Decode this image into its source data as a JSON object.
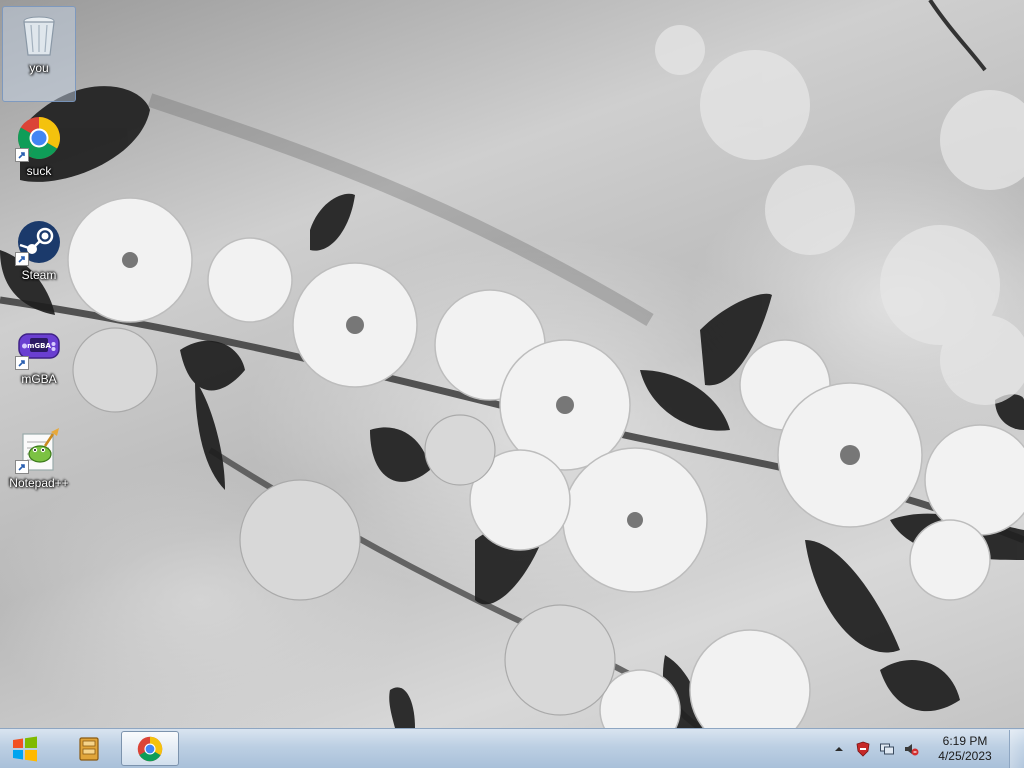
{
  "desktop": {
    "icons": [
      {
        "label": "you",
        "icon": "recycle-bin-icon",
        "shortcut": false,
        "selected": true
      },
      {
        "label": "suck",
        "icon": "chrome-icon",
        "shortcut": true,
        "selected": false
      },
      {
        "label": "Steam",
        "icon": "steam-icon",
        "shortcut": true,
        "selected": false
      },
      {
        "label": "mGBA",
        "icon": "mgba-icon",
        "shortcut": true,
        "selected": false
      },
      {
        "label": "Notepad++",
        "icon": "notepadpp-icon",
        "shortcut": true,
        "selected": false
      }
    ]
  },
  "taskbar": {
    "start": {
      "icon": "windows-logo-icon"
    },
    "pinned": [
      {
        "icon": "file-explorer-icon",
        "active": false
      },
      {
        "icon": "chrome-icon",
        "active": true
      }
    ],
    "tray": {
      "icons": [
        "show-hidden-icons-chevron",
        "security-shield-icon",
        "network-icon",
        "volume-muted-icon"
      ],
      "time": "6:19 PM",
      "date": "4/25/2023"
    }
  },
  "colors": {
    "taskbar_top": "#d9e4f0",
    "taskbar_bottom": "#a9c0d9",
    "chrome_red": "#db4437",
    "chrome_yellow": "#f4c20d",
    "chrome_green": "#0f9d58",
    "chrome_blue": "#4285f4",
    "steam_blue": "#1b3a6b",
    "mgba_purple": "#6a3fd1"
  }
}
